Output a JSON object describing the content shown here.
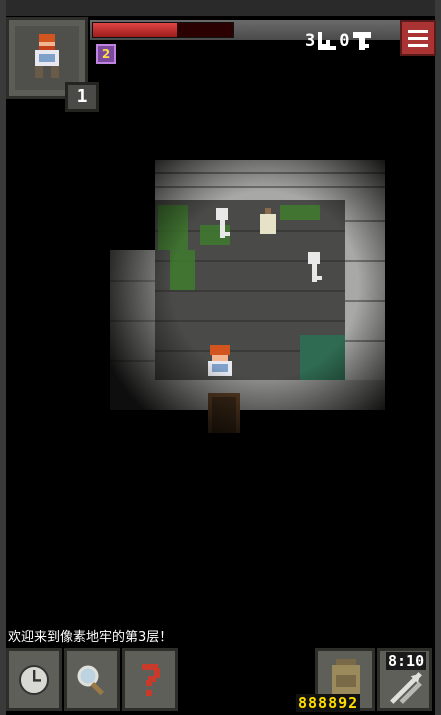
{
  "hud": {
    "hero_level": "1",
    "buff_label": "2",
    "hp_fraction": 0.6,
    "depth": "3",
    "keys": "0",
    "menu_icon": "hamburger-icon"
  },
  "log": {
    "message": "欢迎来到像素地牢的第3层！"
  },
  "toolbar": {
    "wait_icon": "clock-icon",
    "search_icon": "magnifier-icon",
    "info_icon": "question-icon",
    "backpack_icon": "backpack-icon",
    "quickslot_icon": "darts-icon"
  },
  "inventory": {
    "gold": "888892",
    "quickslot_count": "8:10"
  },
  "colors": {
    "hp": "#c82d2d",
    "menu": "#a33333",
    "gold": "#ffdd00"
  }
}
